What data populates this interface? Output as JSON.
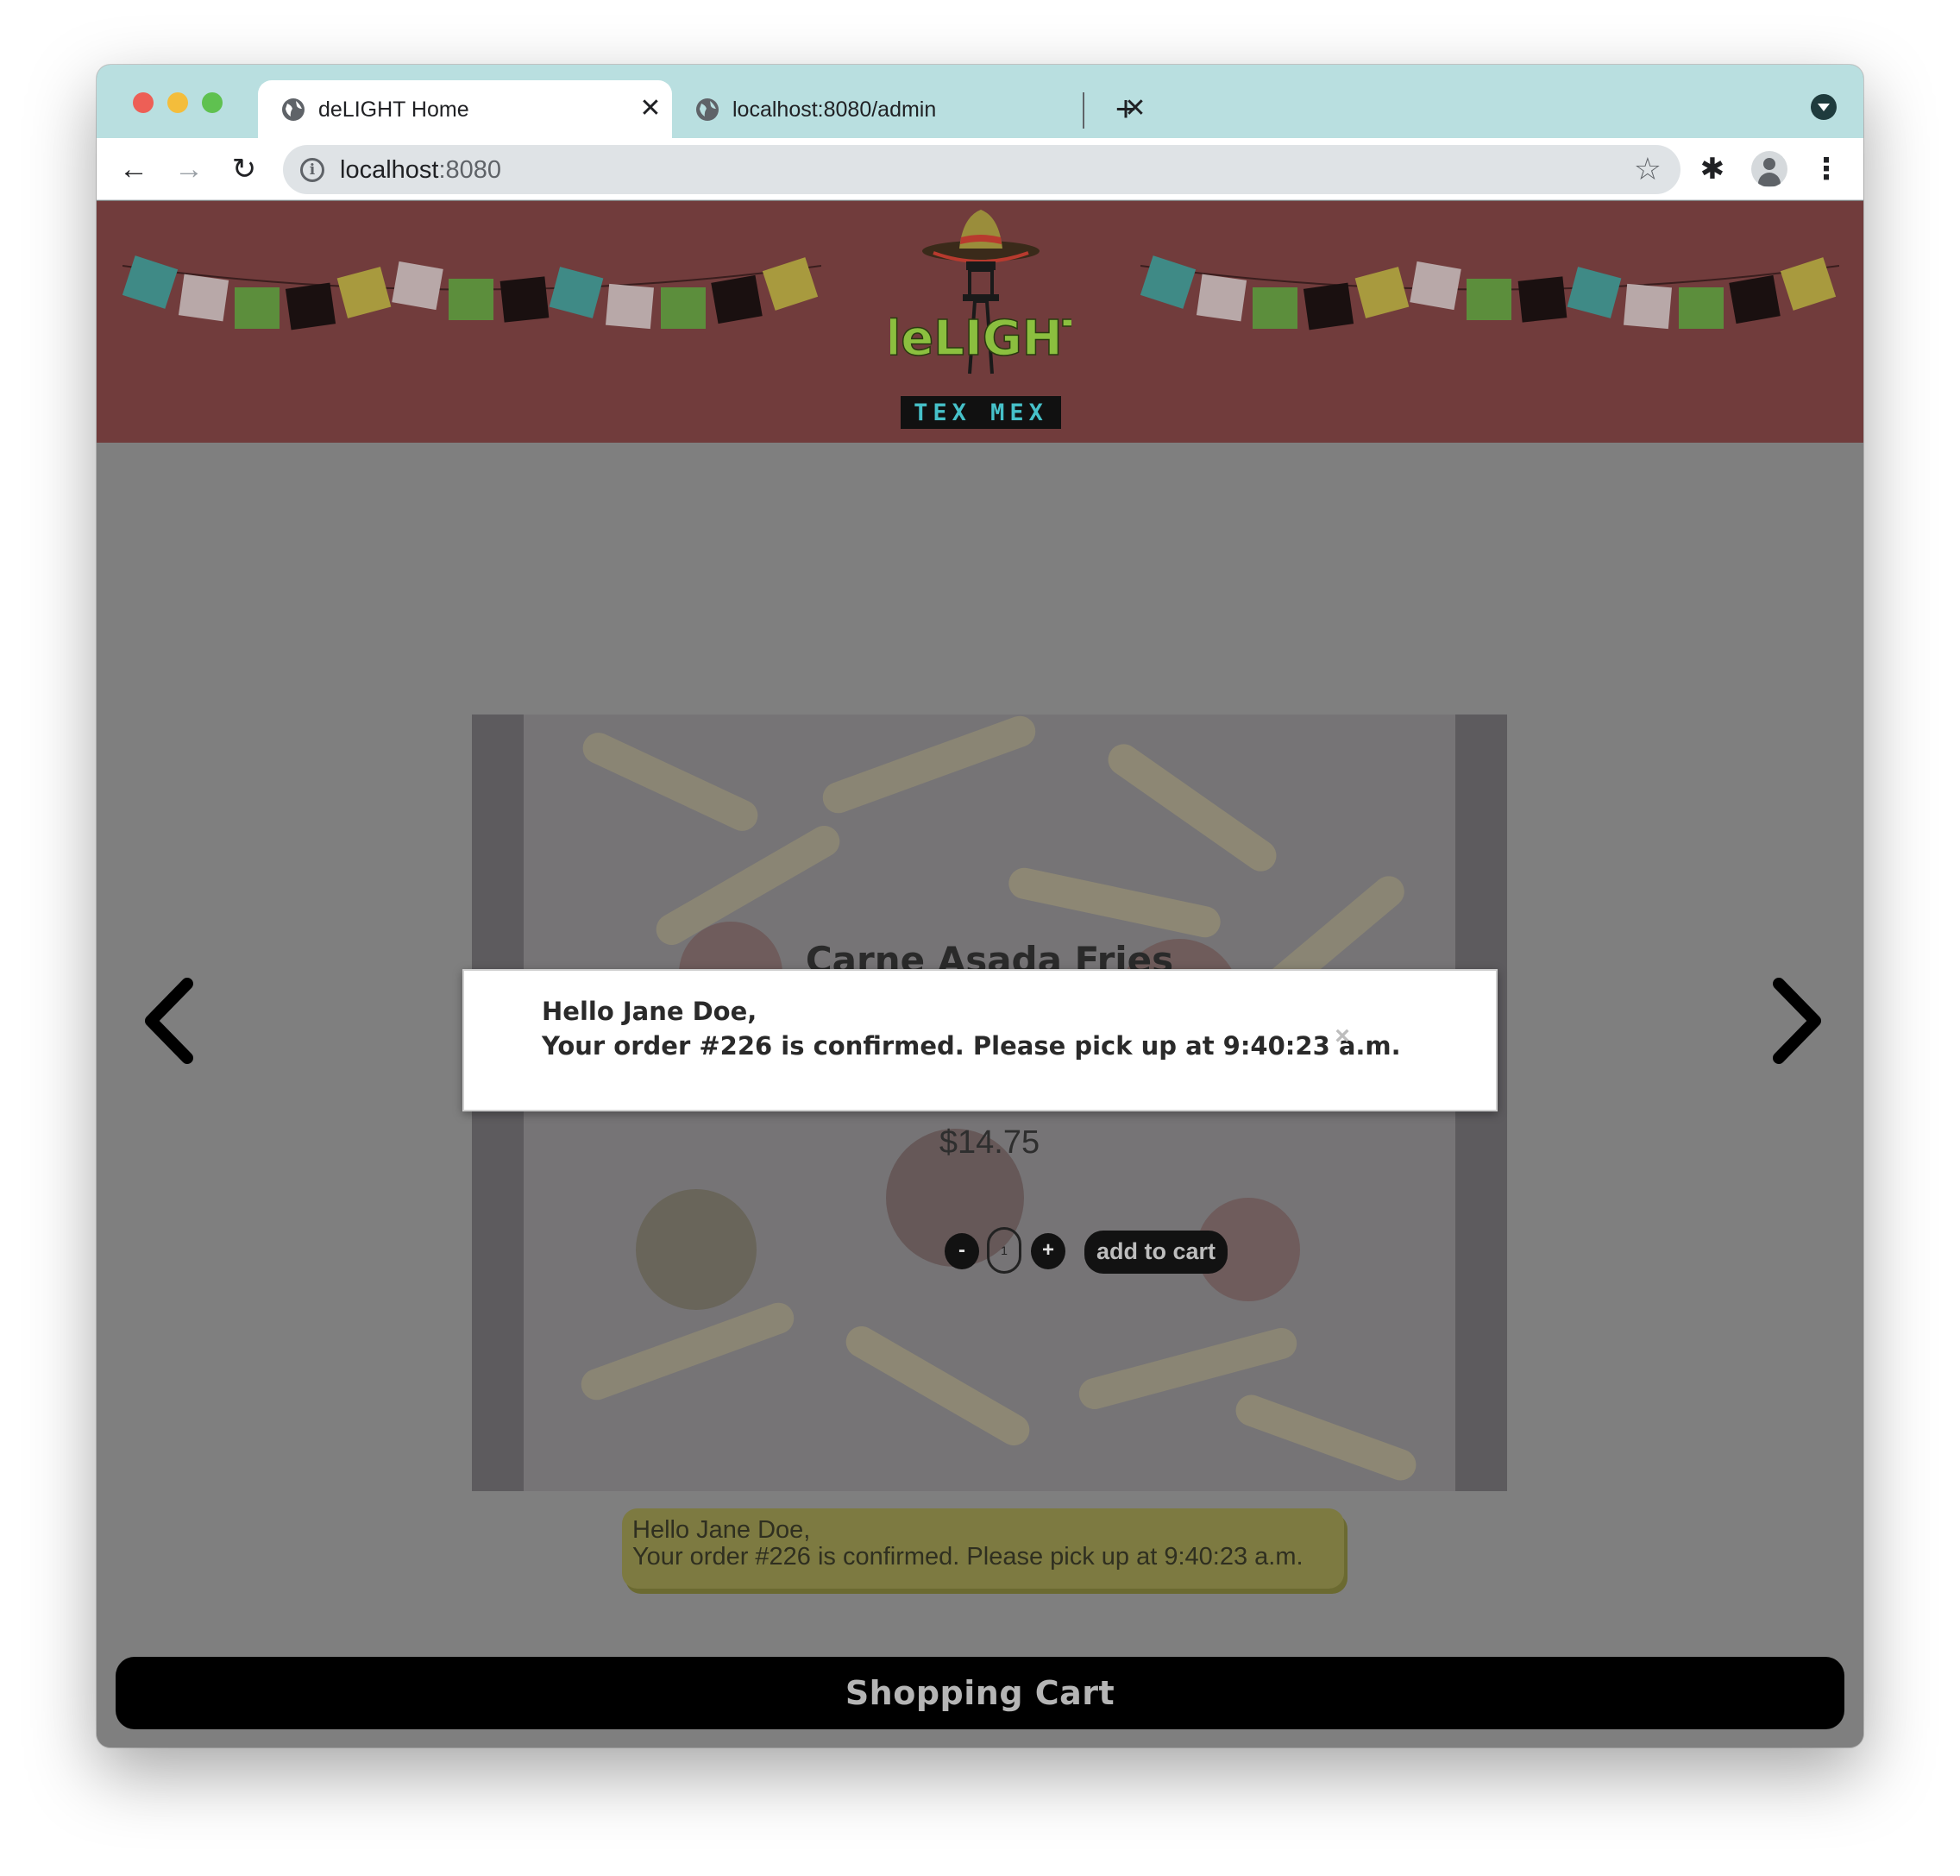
{
  "browser": {
    "tabs": [
      {
        "title": "deLIGHT Home"
      },
      {
        "title": "localhost:8080/admin"
      }
    ],
    "new_tab_label": "+",
    "close_glyph": "✕",
    "address": {
      "host": "localhost",
      "port": ":8080"
    },
    "icons": {
      "back": "←",
      "forward": "→",
      "reload": "↻",
      "star": "☆",
      "extensions": "✱",
      "menu": "⋮",
      "info": "i"
    }
  },
  "header": {
    "logo": {
      "word": "deLIGHT",
      "subtitle": "TEX MEX"
    }
  },
  "product": {
    "name": "Carne Asada Fries",
    "price": "$14.75",
    "quantity": "1",
    "minus_label": "-",
    "plus_label": "+",
    "add_to_cart_label": "add to cart"
  },
  "toast": {
    "line1": "Hello Jane Doe,",
    "line2": "Your order #226 is confirmed. Please pick up at 9:40:23 a.m."
  },
  "modal": {
    "line1": "Hello Jane Doe,",
    "line2": "Your order #226 is confirmed. Please pick up at 9:40:23 a.m.",
    "close_glyph": "×"
  },
  "footer": {
    "cart_label": "Shopping Cart"
  },
  "colors": {
    "tabstrip": "#b9dfe0",
    "header_bg": "#713c3c",
    "overlay_bg": "#7f7f7f",
    "toast_bg": "#7d7a41",
    "logo_green": "#8bbf3f",
    "logo_teal": "#46c1c9"
  }
}
